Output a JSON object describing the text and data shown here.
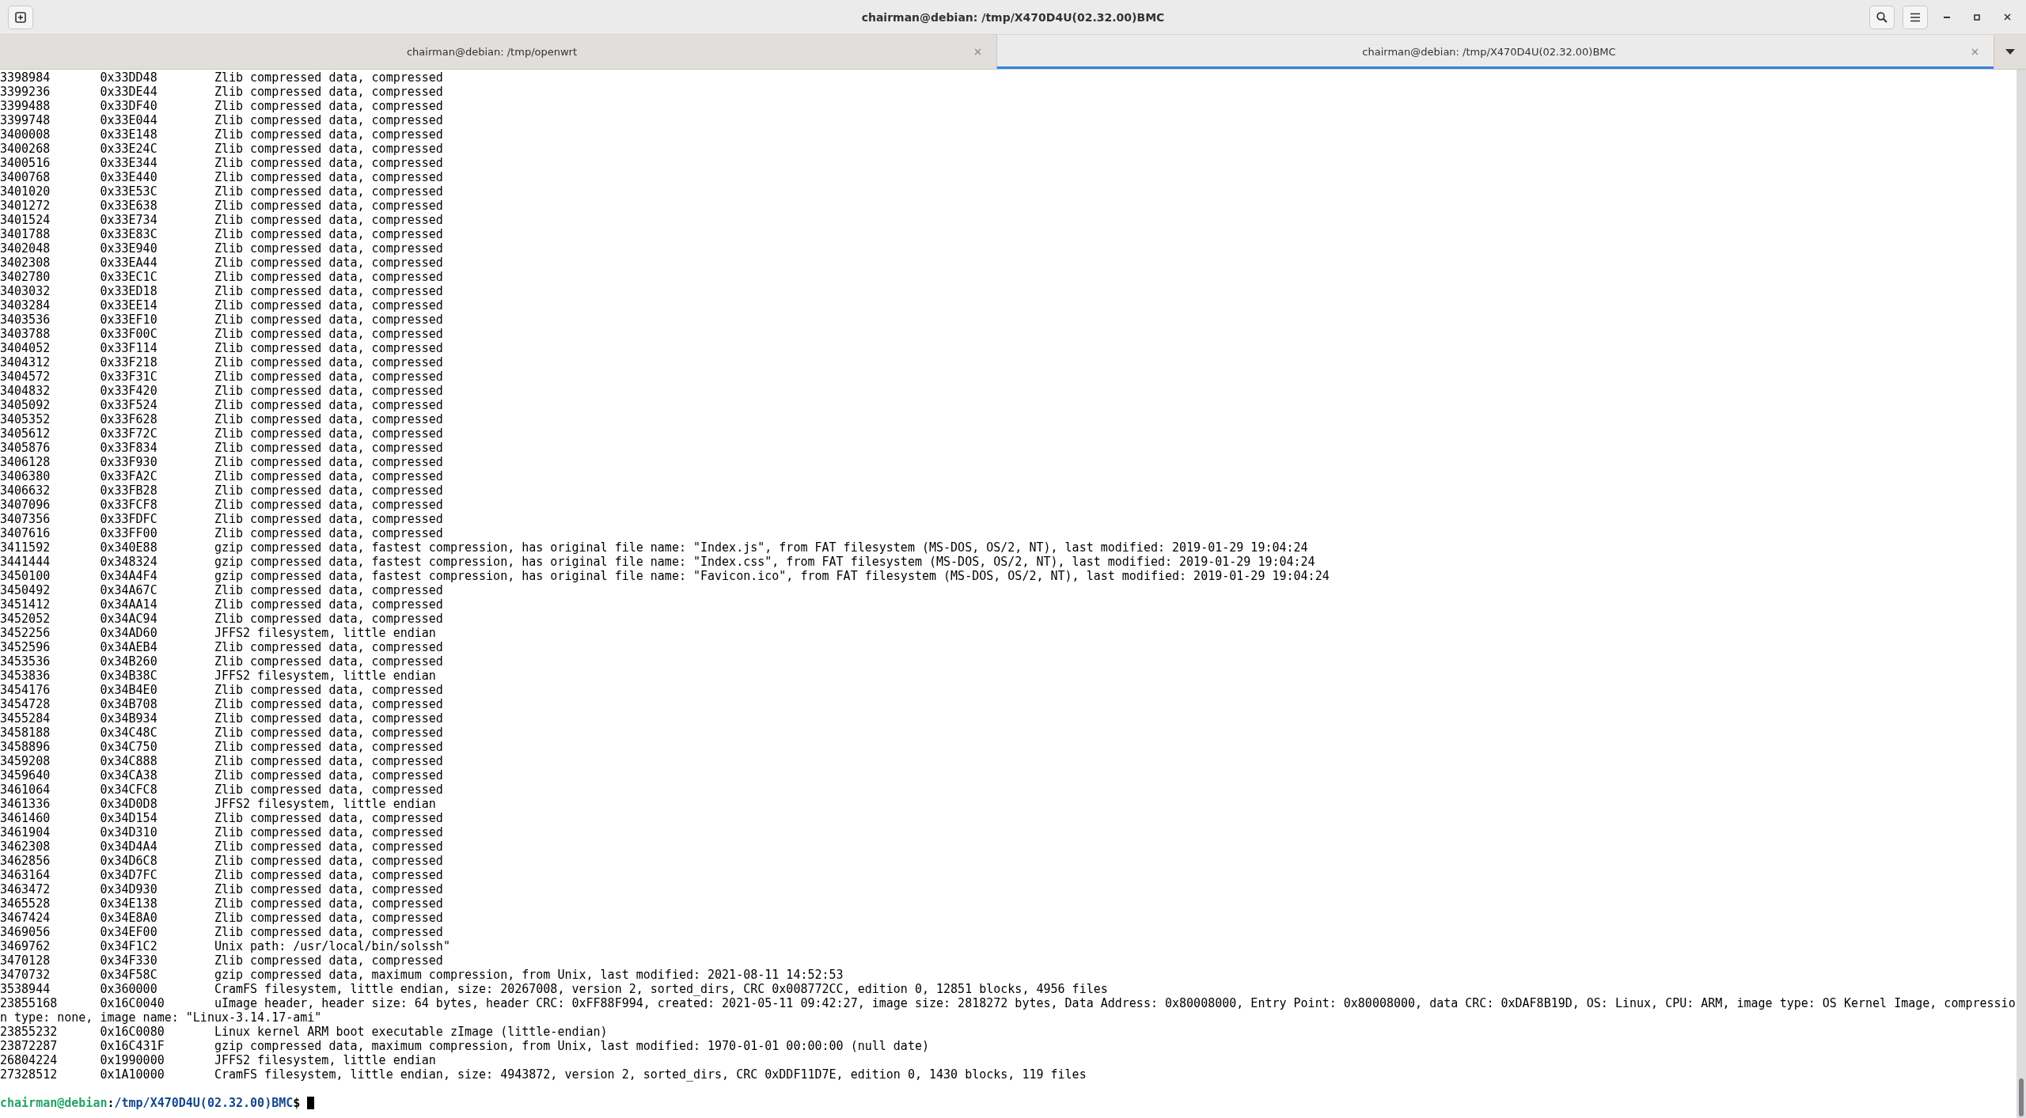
{
  "window": {
    "title": "chairman@debian: /tmp/X470D4U(02.32.00)BMC"
  },
  "tabs": [
    {
      "label": "chairman@debian: /tmp/openwrt",
      "selected": false
    },
    {
      "label": "chairman@debian: /tmp/X470D4U(02.32.00)BMC",
      "selected": true
    }
  ],
  "output": [
    {
      "decimal": "3398984",
      "hexadecimal": "0x33DD48",
      "description": "Zlib compressed data, compressed"
    },
    {
      "decimal": "3399236",
      "hexadecimal": "0x33DE44",
      "description": "Zlib compressed data, compressed"
    },
    {
      "decimal": "3399488",
      "hexadecimal": "0x33DF40",
      "description": "Zlib compressed data, compressed"
    },
    {
      "decimal": "3399748",
      "hexadecimal": "0x33E044",
      "description": "Zlib compressed data, compressed"
    },
    {
      "decimal": "3400008",
      "hexadecimal": "0x33E148",
      "description": "Zlib compressed data, compressed"
    },
    {
      "decimal": "3400268",
      "hexadecimal": "0x33E24C",
      "description": "Zlib compressed data, compressed"
    },
    {
      "decimal": "3400516",
      "hexadecimal": "0x33E344",
      "description": "Zlib compressed data, compressed"
    },
    {
      "decimal": "3400768",
      "hexadecimal": "0x33E440",
      "description": "Zlib compressed data, compressed"
    },
    {
      "decimal": "3401020",
      "hexadecimal": "0x33E53C",
      "description": "Zlib compressed data, compressed"
    },
    {
      "decimal": "3401272",
      "hexadecimal": "0x33E638",
      "description": "Zlib compressed data, compressed"
    },
    {
      "decimal": "3401524",
      "hexadecimal": "0x33E734",
      "description": "Zlib compressed data, compressed"
    },
    {
      "decimal": "3401788",
      "hexadecimal": "0x33E83C",
      "description": "Zlib compressed data, compressed"
    },
    {
      "decimal": "3402048",
      "hexadecimal": "0x33E940",
      "description": "Zlib compressed data, compressed"
    },
    {
      "decimal": "3402308",
      "hexadecimal": "0x33EA44",
      "description": "Zlib compressed data, compressed"
    },
    {
      "decimal": "3402780",
      "hexadecimal": "0x33EC1C",
      "description": "Zlib compressed data, compressed"
    },
    {
      "decimal": "3403032",
      "hexadecimal": "0x33ED18",
      "description": "Zlib compressed data, compressed"
    },
    {
      "decimal": "3403284",
      "hexadecimal": "0x33EE14",
      "description": "Zlib compressed data, compressed"
    },
    {
      "decimal": "3403536",
      "hexadecimal": "0x33EF10",
      "description": "Zlib compressed data, compressed"
    },
    {
      "decimal": "3403788",
      "hexadecimal": "0x33F00C",
      "description": "Zlib compressed data, compressed"
    },
    {
      "decimal": "3404052",
      "hexadecimal": "0x33F114",
      "description": "Zlib compressed data, compressed"
    },
    {
      "decimal": "3404312",
      "hexadecimal": "0x33F218",
      "description": "Zlib compressed data, compressed"
    },
    {
      "decimal": "3404572",
      "hexadecimal": "0x33F31C",
      "description": "Zlib compressed data, compressed"
    },
    {
      "decimal": "3404832",
      "hexadecimal": "0x33F420",
      "description": "Zlib compressed data, compressed"
    },
    {
      "decimal": "3405092",
      "hexadecimal": "0x33F524",
      "description": "Zlib compressed data, compressed"
    },
    {
      "decimal": "3405352",
      "hexadecimal": "0x33F628",
      "description": "Zlib compressed data, compressed"
    },
    {
      "decimal": "3405612",
      "hexadecimal": "0x33F72C",
      "description": "Zlib compressed data, compressed"
    },
    {
      "decimal": "3405876",
      "hexadecimal": "0x33F834",
      "description": "Zlib compressed data, compressed"
    },
    {
      "decimal": "3406128",
      "hexadecimal": "0x33F930",
      "description": "Zlib compressed data, compressed"
    },
    {
      "decimal": "3406380",
      "hexadecimal": "0x33FA2C",
      "description": "Zlib compressed data, compressed"
    },
    {
      "decimal": "3406632",
      "hexadecimal": "0x33FB28",
      "description": "Zlib compressed data, compressed"
    },
    {
      "decimal": "3407096",
      "hexadecimal": "0x33FCF8",
      "description": "Zlib compressed data, compressed"
    },
    {
      "decimal": "3407356",
      "hexadecimal": "0x33FDFC",
      "description": "Zlib compressed data, compressed"
    },
    {
      "decimal": "3407616",
      "hexadecimal": "0x33FF00",
      "description": "Zlib compressed data, compressed"
    },
    {
      "decimal": "3411592",
      "hexadecimal": "0x340E88",
      "description": "gzip compressed data, fastest compression, has original file name: \"Index.js\", from FAT filesystem (MS-DOS, OS/2, NT), last modified: 2019-01-29 19:04:24"
    },
    {
      "decimal": "3441444",
      "hexadecimal": "0x348324",
      "description": "gzip compressed data, fastest compression, has original file name: \"Index.css\", from FAT filesystem (MS-DOS, OS/2, NT), last modified: 2019-01-29 19:04:24"
    },
    {
      "decimal": "3450100",
      "hexadecimal": "0x34A4F4",
      "description": "gzip compressed data, fastest compression, has original file name: \"Favicon.ico\", from FAT filesystem (MS-DOS, OS/2, NT), last modified: 2019-01-29 19:04:24"
    },
    {
      "decimal": "3450492",
      "hexadecimal": "0x34A67C",
      "description": "Zlib compressed data, compressed"
    },
    {
      "decimal": "3451412",
      "hexadecimal": "0x34AA14",
      "description": "Zlib compressed data, compressed"
    },
    {
      "decimal": "3452052",
      "hexadecimal": "0x34AC94",
      "description": "Zlib compressed data, compressed"
    },
    {
      "decimal": "3452256",
      "hexadecimal": "0x34AD60",
      "description": "JFFS2 filesystem, little endian"
    },
    {
      "decimal": "3452596",
      "hexadecimal": "0x34AEB4",
      "description": "Zlib compressed data, compressed"
    },
    {
      "decimal": "3453536",
      "hexadecimal": "0x34B260",
      "description": "Zlib compressed data, compressed"
    },
    {
      "decimal": "3453836",
      "hexadecimal": "0x34B38C",
      "description": "JFFS2 filesystem, little endian"
    },
    {
      "decimal": "3454176",
      "hexadecimal": "0x34B4E0",
      "description": "Zlib compressed data, compressed"
    },
    {
      "decimal": "3454728",
      "hexadecimal": "0x34B708",
      "description": "Zlib compressed data, compressed"
    },
    {
      "decimal": "3455284",
      "hexadecimal": "0x34B934",
      "description": "Zlib compressed data, compressed"
    },
    {
      "decimal": "3458188",
      "hexadecimal": "0x34C48C",
      "description": "Zlib compressed data, compressed"
    },
    {
      "decimal": "3458896",
      "hexadecimal": "0x34C750",
      "description": "Zlib compressed data, compressed"
    },
    {
      "decimal": "3459208",
      "hexadecimal": "0x34C888",
      "description": "Zlib compressed data, compressed"
    },
    {
      "decimal": "3459640",
      "hexadecimal": "0x34CA38",
      "description": "Zlib compressed data, compressed"
    },
    {
      "decimal": "3461064",
      "hexadecimal": "0x34CFC8",
      "description": "Zlib compressed data, compressed"
    },
    {
      "decimal": "3461336",
      "hexadecimal": "0x34D0D8",
      "description": "JFFS2 filesystem, little endian"
    },
    {
      "decimal": "3461460",
      "hexadecimal": "0x34D154",
      "description": "Zlib compressed data, compressed"
    },
    {
      "decimal": "3461904",
      "hexadecimal": "0x34D310",
      "description": "Zlib compressed data, compressed"
    },
    {
      "decimal": "3462308",
      "hexadecimal": "0x34D4A4",
      "description": "Zlib compressed data, compressed"
    },
    {
      "decimal": "3462856",
      "hexadecimal": "0x34D6C8",
      "description": "Zlib compressed data, compressed"
    },
    {
      "decimal": "3463164",
      "hexadecimal": "0x34D7FC",
      "description": "Zlib compressed data, compressed"
    },
    {
      "decimal": "3463472",
      "hexadecimal": "0x34D930",
      "description": "Zlib compressed data, compressed"
    },
    {
      "decimal": "3465528",
      "hexadecimal": "0x34E138",
      "description": "Zlib compressed data, compressed"
    },
    {
      "decimal": "3467424",
      "hexadecimal": "0x34E8A0",
      "description": "Zlib compressed data, compressed"
    },
    {
      "decimal": "3469056",
      "hexadecimal": "0x34EF00",
      "description": "Zlib compressed data, compressed"
    },
    {
      "decimal": "3469762",
      "hexadecimal": "0x34F1C2",
      "description": "Unix path: /usr/local/bin/solssh\""
    },
    {
      "decimal": "3470128",
      "hexadecimal": "0x34F330",
      "description": "Zlib compressed data, compressed"
    },
    {
      "decimal": "3470732",
      "hexadecimal": "0x34F58C",
      "description": "gzip compressed data, maximum compression, from Unix, last modified: 2021-08-11 14:52:53"
    },
    {
      "decimal": "3538944",
      "hexadecimal": "0x360000",
      "description": "CramFS filesystem, little endian, size: 20267008, version 2, sorted_dirs, CRC 0x008772CC, edition 0, 12851 blocks, 4956 files"
    },
    {
      "decimal": "23855168",
      "hexadecimal": "0x16C0040",
      "description": "uImage header, header size: 64 bytes, header CRC: 0xFF88F994, created: 2021-05-11 09:42:27, image size: 2818272 bytes, Data Address: 0x80008000, Entry Point: 0x80008000, data CRC: 0xDAF8B19D, OS: Linux, CPU: ARM, image type: OS Kernel Image, compression type: none, image name: \"Linux-3.14.17-ami\""
    },
    {
      "decimal": "23855232",
      "hexadecimal": "0x16C0080",
      "description": "Linux kernel ARM boot executable zImage (little-endian)"
    },
    {
      "decimal": "23872287",
      "hexadecimal": "0x16C431F",
      "description": "gzip compressed data, maximum compression, from Unix, last modified: 1970-01-01 00:00:00 (null date)"
    },
    {
      "decimal": "26804224",
      "hexadecimal": "0x1990000",
      "description": "JFFS2 filesystem, little endian"
    },
    {
      "decimal": "27328512",
      "hexadecimal": "0x1A10000",
      "description": "CramFS filesystem, little endian, size: 4943872, version 2, sorted_dirs, CRC 0xDDF11D7E, edition 0, 1430 blocks, 119 files"
    }
  ],
  "prompt": {
    "user_host": "chairman@debian",
    "separator": ":",
    "path": "/tmp/X470D4U(02.32.00)BMC",
    "symbol": "$"
  }
}
